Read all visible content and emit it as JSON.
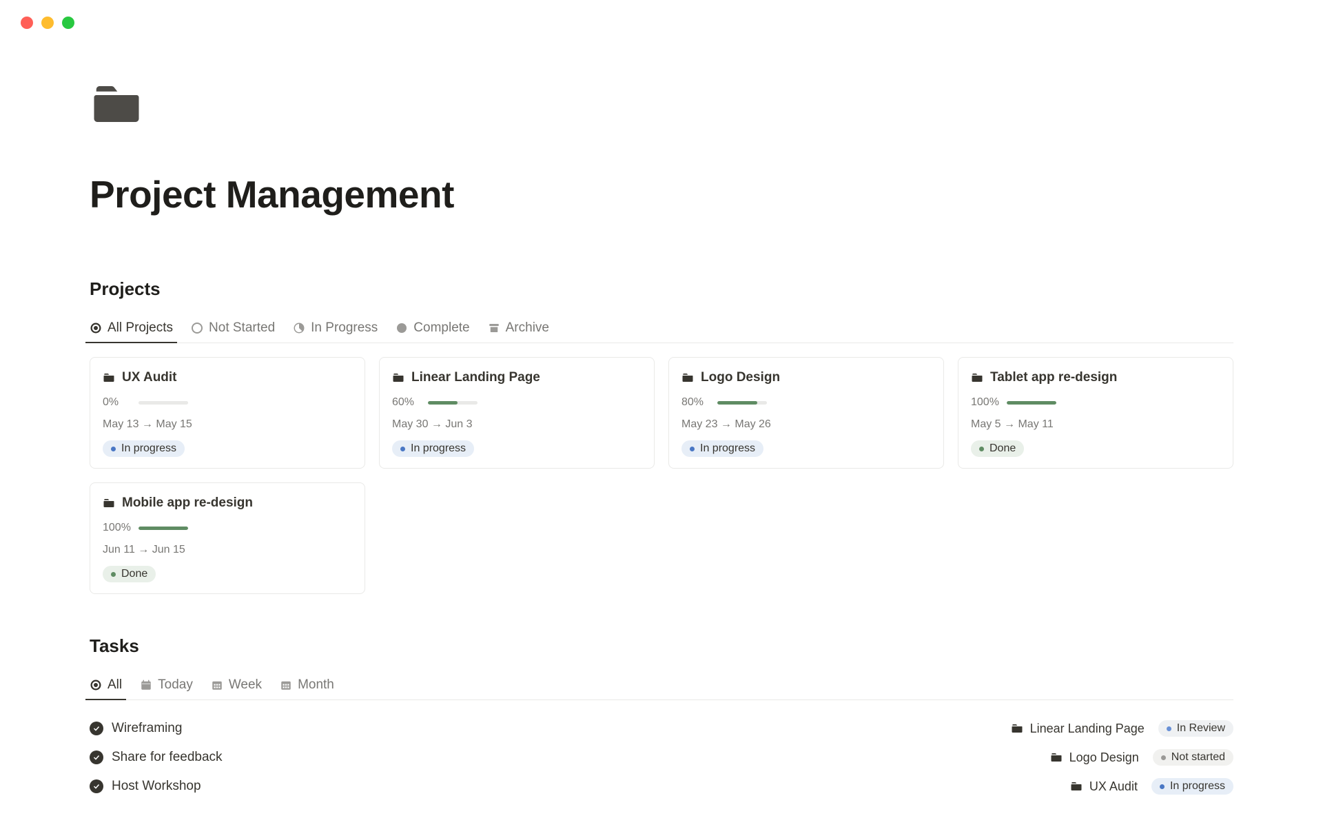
{
  "page": {
    "title": "Project Management"
  },
  "sections": {
    "projects": {
      "title": "Projects"
    },
    "tasks": {
      "title": "Tasks"
    }
  },
  "projectTabs": [
    {
      "label": "All Projects",
      "icon": "target"
    },
    {
      "label": "Not Started",
      "icon": "circle-outline"
    },
    {
      "label": "In Progress",
      "icon": "pie"
    },
    {
      "label": "Complete",
      "icon": "circle-solid"
    },
    {
      "label": "Archive",
      "icon": "archive"
    }
  ],
  "taskTabs": [
    {
      "label": "All",
      "icon": "target"
    },
    {
      "label": "Today",
      "icon": "calendar"
    },
    {
      "label": "Week",
      "icon": "calendar-grid"
    },
    {
      "label": "Month",
      "icon": "calendar-grid"
    }
  ],
  "projects": [
    {
      "name": "UX Audit",
      "pct": "0%",
      "pctVal": 0,
      "dates": "May 13 → May 15",
      "status": "In progress",
      "statusKind": "inprogress"
    },
    {
      "name": "Linear Landing Page",
      "pct": "60%",
      "pctVal": 60,
      "dates": "May 30 → Jun 3",
      "status": "In progress",
      "statusKind": "inprogress"
    },
    {
      "name": "Logo Design",
      "pct": "80%",
      "pctVal": 80,
      "dates": "May 23 → May 26",
      "status": "In progress",
      "statusKind": "inprogress"
    },
    {
      "name": "Tablet app re-design",
      "pct": "100%",
      "pctVal": 100,
      "dates": "May 5 → May 11",
      "status": "Done",
      "statusKind": "done"
    },
    {
      "name": "Mobile app re-design",
      "pct": "100%",
      "pctVal": 100,
      "dates": "Jun 11 → Jun 15",
      "status": "Done",
      "statusKind": "done"
    }
  ],
  "tasks": [
    {
      "name": "Wireframing",
      "project": "Linear Landing Page",
      "status": "In Review",
      "statusKind": "review"
    },
    {
      "name": "Share for feedback",
      "project": "Logo Design",
      "status": "Not started",
      "statusKind": "notstarted"
    },
    {
      "name": "Host Workshop",
      "project": "UX Audit",
      "status": "In progress",
      "statusKind": "inprogress"
    }
  ]
}
